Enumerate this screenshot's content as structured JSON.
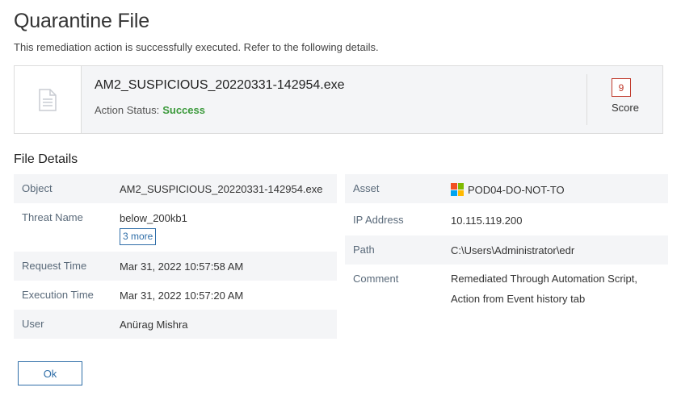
{
  "dialog": {
    "title": "Quarantine File",
    "subtitle": "This remediation action is successfully executed. Refer to the following details."
  },
  "file_card": {
    "icon": "document-icon",
    "file_name": "AM2_SUSPICIOUS_20220331-142954.exe",
    "status_label": "Action Status:",
    "status_value": "Success",
    "score_value": "9",
    "score_label": "Score"
  },
  "file_details": {
    "section_title": "File Details",
    "left": [
      {
        "label": "Object",
        "value": "AM2_SUSPICIOUS_20220331-142954.exe"
      },
      {
        "label": "Threat Name",
        "value": "below_200kb1",
        "more_label": "3 more"
      },
      {
        "label": "Request Time",
        "value": "Mar 31, 2022 10:57:58 AM"
      },
      {
        "label": "Execution Time",
        "value": "Mar 31, 2022 10:57:20 AM"
      },
      {
        "label": "User",
        "value": "Anürag Mishra"
      }
    ],
    "right": [
      {
        "label": "Asset",
        "value": "POD04-DO-NOT-TO",
        "icon": "windows-icon"
      },
      {
        "label": "IP Address",
        "value": "10.115.119.200"
      },
      {
        "label": "Path",
        "value": "C:\\Users\\Administrator\\edr"
      },
      {
        "label": "Comment",
        "value_line1": "Remediated Through Automation Script,",
        "value_line2": "Action from Event history tab"
      }
    ]
  },
  "footer": {
    "ok_label": "Ok"
  },
  "colors": {
    "success": "#3c9a3c",
    "score_border": "#c0392b",
    "link": "#2f6ea8",
    "shaded_row": "#f4f5f7"
  }
}
